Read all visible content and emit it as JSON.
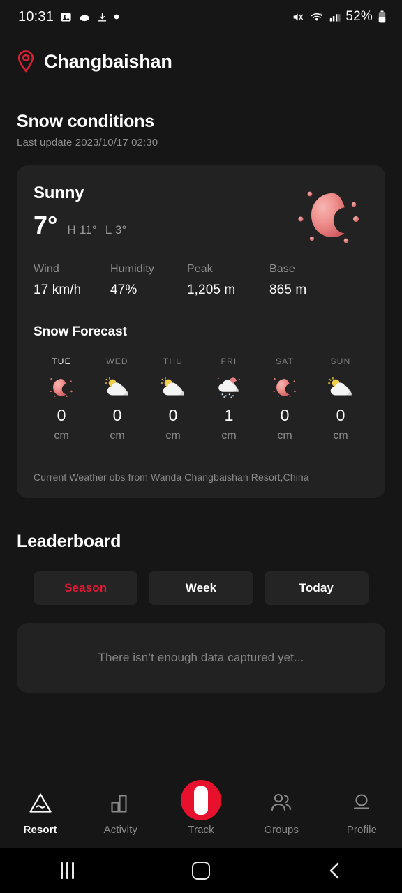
{
  "status_bar": {
    "time": "10:31",
    "battery_percent": "52%",
    "left_icons": [
      "image-icon",
      "disc-icon",
      "download-icon",
      "dot-icon"
    ],
    "right_icons": [
      "mute-icon",
      "wifi-6-icon",
      "cellular-signal-icon",
      "battery-icon"
    ]
  },
  "header": {
    "location_name": "Changbaishan",
    "pin_icon": "location-pin-icon",
    "pin_color": "#d91f34"
  },
  "snow_conditions": {
    "title": "Snow conditions",
    "last_update": "Last update 2023/10/17 02:30",
    "condition": "Sunny",
    "condition_icon": "crescent-moon-icon",
    "temperature": "7°",
    "high": "H 11°",
    "low": "L 3°",
    "metrics": [
      {
        "label": "Wind",
        "value": "17 km/h"
      },
      {
        "label": "Humidity",
        "value": "47%"
      },
      {
        "label": "Peak",
        "value": "1,205 m"
      },
      {
        "label": "Base",
        "value": "865 m"
      }
    ],
    "forecast_title": "Snow Forecast",
    "forecast": [
      {
        "day": "TUE",
        "icon": "crescent-moon-icon",
        "value": "0",
        "unit": "cm",
        "today": true
      },
      {
        "day": "WED",
        "icon": "sun-behind-cloud-icon",
        "value": "0",
        "unit": "cm",
        "today": false
      },
      {
        "day": "THU",
        "icon": "sun-behind-cloud-icon",
        "value": "0",
        "unit": "cm",
        "today": false
      },
      {
        "day": "FRI",
        "icon": "snow-cloud-moon-icon",
        "value": "1",
        "unit": "cm",
        "today": false
      },
      {
        "day": "SAT",
        "icon": "crescent-moon-icon",
        "value": "0",
        "unit": "cm",
        "today": false
      },
      {
        "day": "SUN",
        "icon": "sun-behind-cloud-icon",
        "value": "0",
        "unit": "cm",
        "today": false
      }
    ],
    "note": "Current Weather obs from Wanda Changbaishan Resort,China"
  },
  "leaderboard": {
    "title": "Leaderboard",
    "tabs": [
      {
        "label": "Season",
        "active": true
      },
      {
        "label": "Week",
        "active": false
      },
      {
        "label": "Today",
        "active": false
      }
    ],
    "empty_message": "There isn’t enough data captured yet...",
    "active_color": "#e01933"
  },
  "tab_bar": {
    "items": [
      {
        "label": "Resort",
        "icon": "mountain-icon",
        "active": true
      },
      {
        "label": "Activity",
        "icon": "bar-chart-icon",
        "active": false
      },
      {
        "label": "Track",
        "icon": "track-record-icon",
        "active": false
      },
      {
        "label": "Groups",
        "icon": "people-icon",
        "active": false
      },
      {
        "label": "Profile",
        "icon": "person-icon",
        "active": false
      }
    ],
    "track_accent": "#e8112d"
  },
  "android_nav": {
    "recents": "recents-icon",
    "home": "home-icon",
    "back": "back-icon"
  }
}
